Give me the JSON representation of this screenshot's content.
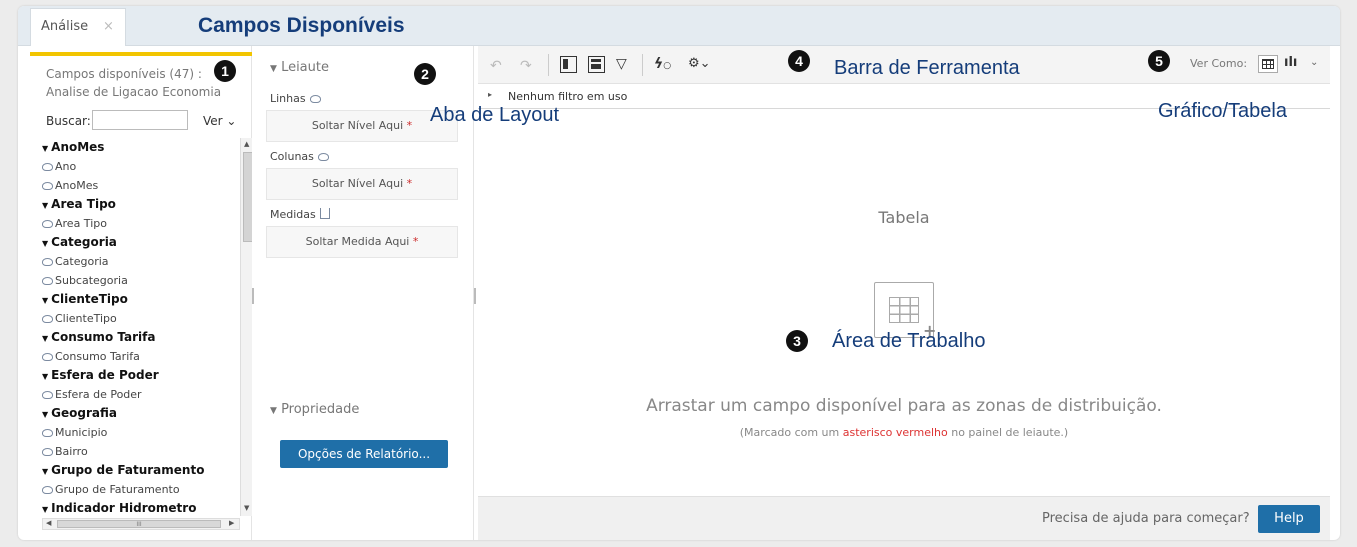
{
  "tab": {
    "label": "Análise",
    "close": "×"
  },
  "annotations": {
    "campos": "Campos Disponíveis",
    "layout": "Aba de Layout",
    "toolbar": "Barra de Ferramenta",
    "grafico": "Gráfico/Tabela",
    "area": "Área de Trabalho",
    "badge1": "1",
    "badge2": "2",
    "badge3": "3",
    "badge4": "4",
    "badge5": "5"
  },
  "fields": {
    "title": "Campos disponíveis (47) :",
    "subtitle": "Analise de Ligacao Economia",
    "search_label": "Buscar:",
    "search_value": "",
    "view_label": "Ver ⌄",
    "tree": [
      {
        "label": "AnoMes",
        "type": "group"
      },
      {
        "label": "Ano",
        "type": "level"
      },
      {
        "label": "AnoMes",
        "type": "level"
      },
      {
        "label": "Area Tipo",
        "type": "group"
      },
      {
        "label": "Area Tipo",
        "type": "level"
      },
      {
        "label": "Categoria",
        "type": "group"
      },
      {
        "label": "Categoria",
        "type": "level"
      },
      {
        "label": "Subcategoria",
        "type": "level"
      },
      {
        "label": "ClienteTipo",
        "type": "group"
      },
      {
        "label": "ClienteTipo",
        "type": "level"
      },
      {
        "label": "Consumo Tarifa",
        "type": "group"
      },
      {
        "label": "Consumo Tarifa",
        "type": "level"
      },
      {
        "label": "Esfera de Poder",
        "type": "group"
      },
      {
        "label": "Esfera de Poder",
        "type": "level"
      },
      {
        "label": "Geografia",
        "type": "group"
      },
      {
        "label": "Municipio",
        "type": "level"
      },
      {
        "label": "Bairro",
        "type": "level"
      },
      {
        "label": "Grupo de Faturamento",
        "type": "group"
      },
      {
        "label": "Grupo de Faturamento",
        "type": "level"
      },
      {
        "label": "Indicador Hidrometro",
        "type": "group"
      }
    ]
  },
  "layout": {
    "section_title": "Leiaute",
    "rows_label": "Linhas",
    "rows_drop": "Soltar Nível Aqui",
    "columns_label": "Colunas",
    "columns_drop": "Soltar Nível Aqui",
    "measures_label": "Medidas",
    "measures_drop": "Soltar Medida Aqui",
    "required_mark": "*",
    "properties_title": "Propriedade",
    "report_button": "Opções de Relatório..."
  },
  "toolbar": {
    "undo": "↶",
    "redo": "↷",
    "filter": "▽",
    "settings": "⚙⌄",
    "view_as": "Ver Como:",
    "chart": "ılı",
    "caret": "⌄"
  },
  "filter": {
    "arrow": "▸",
    "text": "Nenhum filtro em uso"
  },
  "canvas": {
    "title": "Tabela",
    "drag_text": "Arrastar um campo disponível para as zonas de distribuição.",
    "hint_before": "(Marcado com um ",
    "hint_red": "asterisco vermelho",
    "hint_after": " no painel de leiaute.)",
    "plus": "+"
  },
  "help": {
    "text": "Precisa de ajuda para começar?",
    "button": "Help"
  }
}
